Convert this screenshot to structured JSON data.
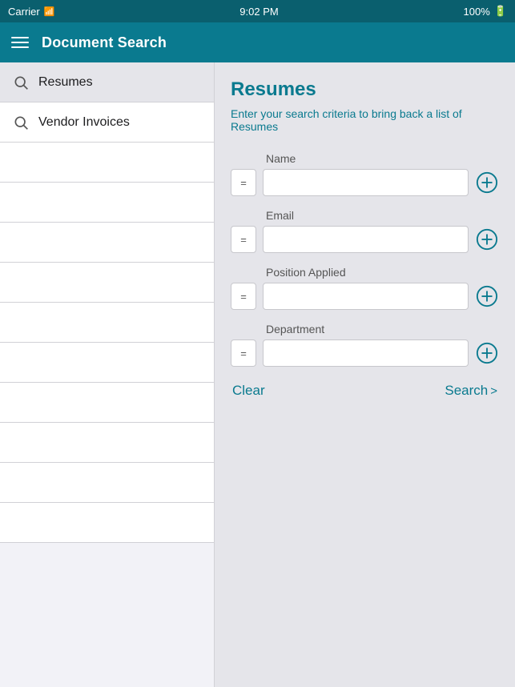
{
  "status_bar": {
    "carrier": "Carrier",
    "wifi": "wifi",
    "time": "9:02 PM",
    "battery": "100%"
  },
  "nav": {
    "title": "Document Search",
    "menu_icon": "hamburger"
  },
  "sidebar": {
    "items": [
      {
        "label": "Resumes",
        "active": true
      },
      {
        "label": "Vendor Invoices",
        "active": false
      }
    ],
    "empty_rows": 10
  },
  "content": {
    "title": "Resumes",
    "subtitle": "Enter your search criteria to bring back a list of Resumes",
    "fields": [
      {
        "label": "Name",
        "placeholder": "",
        "equals": "="
      },
      {
        "label": "Email",
        "placeholder": "",
        "equals": "="
      },
      {
        "label": "Position Applied",
        "placeholder": "",
        "equals": "="
      },
      {
        "label": "Department",
        "placeholder": "",
        "equals": "="
      }
    ],
    "clear_label": "Clear",
    "search_label": "Search",
    "search_chevron": ">"
  }
}
